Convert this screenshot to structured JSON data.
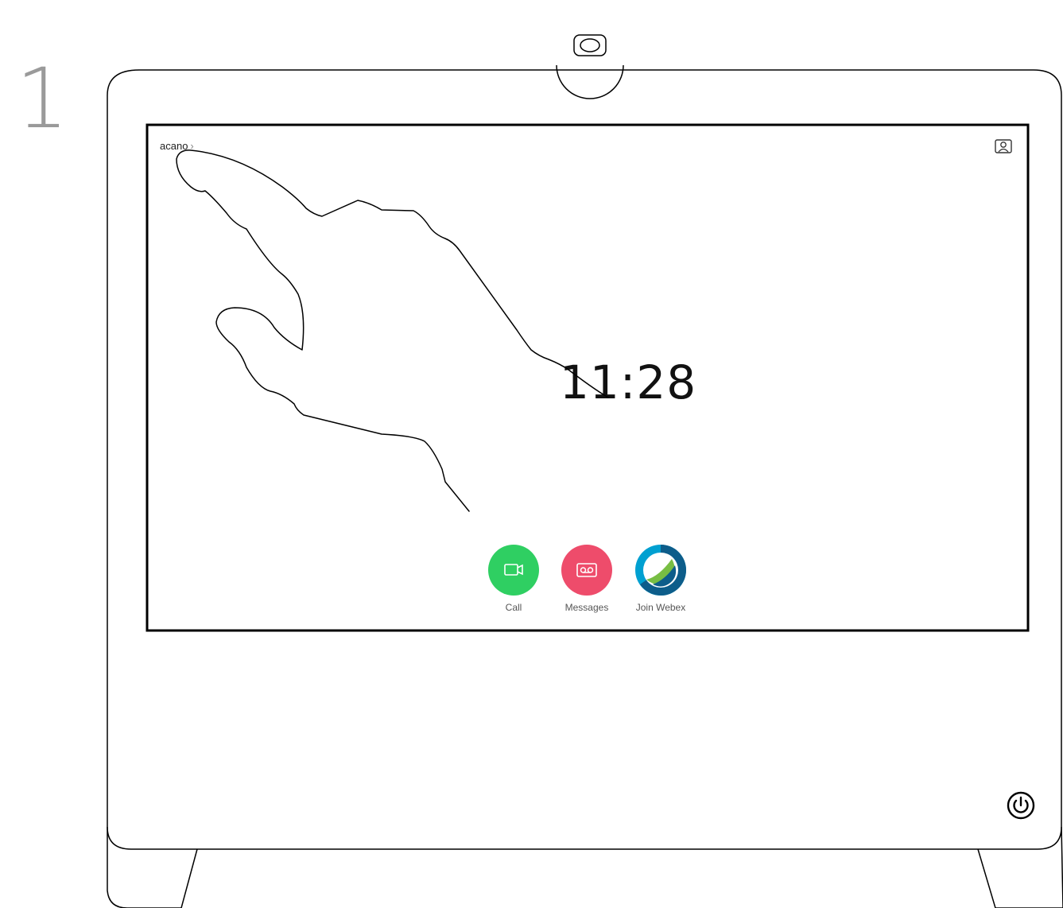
{
  "step_number": "1",
  "header": {
    "breadcrumb_label": "acano",
    "breadcrumb_chevron": "›",
    "selfview_icon": "selfview-icon"
  },
  "clock": {
    "time": "11:28"
  },
  "actions": [
    {
      "label": "Call",
      "icon": "video-camera-icon",
      "color": "#2fcf62"
    },
    {
      "label": "Messages",
      "icon": "voicemail-icon",
      "color": "#ee4c6b"
    },
    {
      "label": "Join Webex",
      "icon": "webex-logo-icon",
      "color": "#00a0d1"
    }
  ],
  "device": {
    "power_icon": "power-icon"
  }
}
